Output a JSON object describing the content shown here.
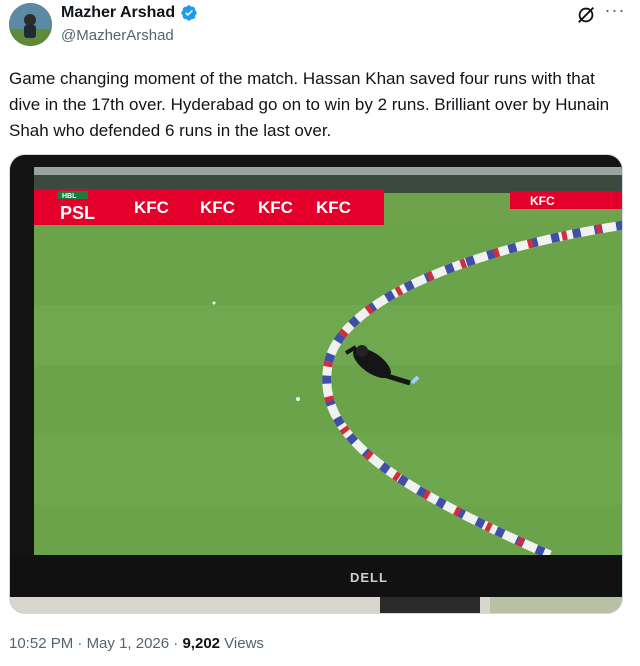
{
  "author": {
    "display_name": "Mazher Arshad",
    "handle": "@MazherArshad",
    "verified": true
  },
  "tweet": {
    "text": "Game changing moment of the match. Hassan Khan saved four runs with that dive in the 17th over. Hyderabad go on to win by 2 runs. Brilliant over by Hunain Shah who defended 6 runs in the last over."
  },
  "media": {
    "monitor_brand": "DELL",
    "league_logo": "PSL",
    "sponsor_text": "KFC",
    "hbl_text": "HBL"
  },
  "meta": {
    "time": "10:52 PM",
    "sep1": " · ",
    "date": "May 1, 2026",
    "sep2": " · ",
    "views_count": "9,202",
    "views_label": " Views"
  },
  "colors": {
    "verified_blue": "#1d9bf0",
    "pitch_green": "#6fa64e",
    "kfc_red": "#e4002b"
  },
  "icons": [
    "verified-badge-icon",
    "grok-icon",
    "more-icon"
  ]
}
